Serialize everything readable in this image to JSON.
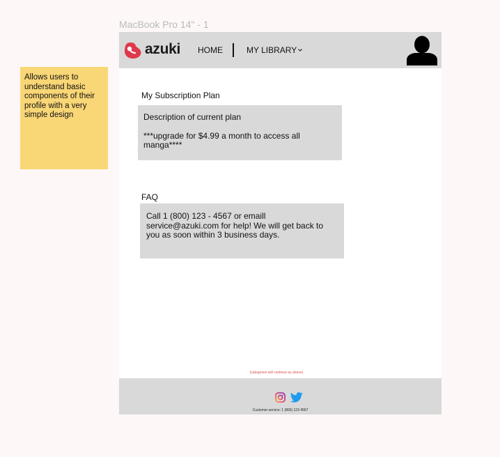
{
  "frame_title": "MacBook Pro 14\" - 1",
  "sticky_note": "Allows users to understand basic components of their profile with a very simple design",
  "header": {
    "logo_text": "azuki",
    "nav": {
      "home": "HOME",
      "library": "MY LIBRARY"
    }
  },
  "subscription": {
    "label": "My Subscription Plan",
    "description": "Description of current plan",
    "upgrade": "***upgrade for $4.99 a month to access all manga****"
  },
  "faq": {
    "label": "FAQ",
    "text": "Call 1 (800) 123 - 4567 or emaill service@azuki.com for help! We will get back to you as soon within 3 business days."
  },
  "footer": {
    "note": "(categories will continue as above)",
    "service": "Customer service: 1 (800) 123 4567"
  },
  "colors": {
    "bar": "#d9d9d9",
    "sticky": "#f9d676",
    "logo_red": "#e0384b",
    "twitter": "#1d9bf0"
  },
  "icons": [
    "azuki-logo-icon",
    "chevron-down-icon",
    "avatar-icon",
    "instagram-icon",
    "twitter-icon"
  ]
}
